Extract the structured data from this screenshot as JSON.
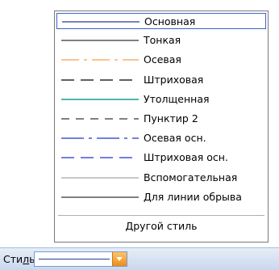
{
  "line_styles": [
    {
      "label": "Основная",
      "color": "#2a3a9a",
      "dash": "",
      "width": 1.2,
      "selected": true
    },
    {
      "label": "Тонкая",
      "color": "#000000",
      "dash": "",
      "width": 1,
      "selected": false
    },
    {
      "label": "Осевая",
      "color": "#f08c1e",
      "dash": "22 6 4 6",
      "width": 1,
      "selected": false
    },
    {
      "label": "Штриховая",
      "color": "#000000",
      "dash": "16 8",
      "width": 1.2,
      "selected": false
    },
    {
      "label": "Утолщенная",
      "color": "#1a9a9a",
      "dash": "",
      "width": 1.4,
      "selected": false
    },
    {
      "label": "Пунктир 2",
      "color": "#000000",
      "dash": "10 8",
      "width": 1,
      "selected": false
    },
    {
      "label": "Осевая осн.",
      "color": "#2233cc",
      "dash": "28 6 4 6",
      "width": 1.2,
      "selected": false
    },
    {
      "label": "Штриховая осн.",
      "color": "#2233cc",
      "dash": "16 8",
      "width": 1.2,
      "selected": false
    },
    {
      "label": "Вспомогательная",
      "color": "#909090",
      "dash": "",
      "width": 1,
      "selected": false
    },
    {
      "label": "Для линии обрыва",
      "color": "#000000",
      "dash": "",
      "width": 1,
      "selected": false
    }
  ],
  "other_style_label": "Другой стиль",
  "toolbar": {
    "style_label_prefix": "Сти",
    "style_label_underlined": "л",
    "style_label_suffix": "ь",
    "combo_line_color": "#2a3a9a"
  }
}
